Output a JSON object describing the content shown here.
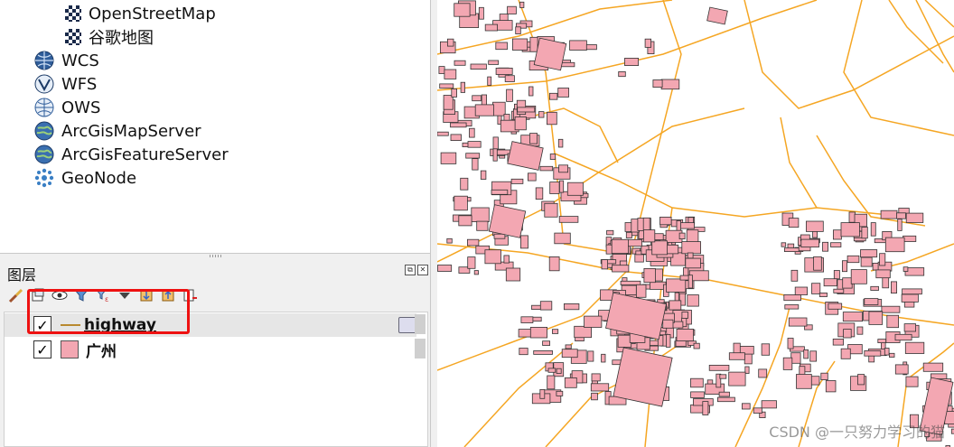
{
  "browser": {
    "items": [
      {
        "label": "OpenStreetMap",
        "icon": "xyz-tile-icon"
      },
      {
        "label": "谷歌地图",
        "icon": "xyz-tile-icon"
      },
      {
        "label": "WCS",
        "icon": "wcs-globe-icon"
      },
      {
        "label": "WFS",
        "icon": "wfs-globe-icon"
      },
      {
        "label": "OWS",
        "icon": "ows-globe-icon"
      },
      {
        "label": "ArcGisMapServer",
        "icon": "arcgis-map-server-icon"
      },
      {
        "label": "ArcGisFeatureServer",
        "icon": "arcgis-feature-server-icon"
      },
      {
        "label": "GeoNode",
        "icon": "geonode-icon"
      }
    ]
  },
  "layers_panel": {
    "title": "图层",
    "toolbar_icons": [
      "style-manager-icon",
      "add-group-icon",
      "manage-visibility-icon",
      "filter-legend-icon",
      "filter-expression-icon",
      "expand-icon",
      "collapse-icon",
      "remove-layer-icon"
    ],
    "layers": [
      {
        "name": "highway",
        "checked": true,
        "symbol": "line",
        "color": "#b8892f",
        "selected": true
      },
      {
        "name": "广州",
        "checked": true,
        "symbol": "polygon",
        "color": "#f3a7b2",
        "selected": false
      }
    ]
  },
  "map": {
    "road_color": "#f5a623",
    "building_fill": "#f3a7b2",
    "building_stroke": "#333333"
  },
  "watermark": "CSDN @一只努力学习的猫"
}
